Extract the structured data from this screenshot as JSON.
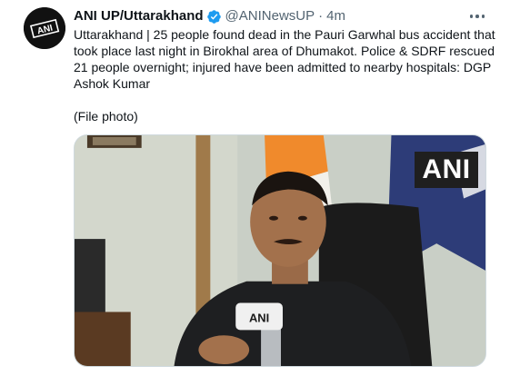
{
  "tweet": {
    "author_name": "ANI UP/Uttarakhand",
    "handle": "@ANINewsUP",
    "separator": "·",
    "time": "4m",
    "body": "Uttarakhand | 25 people found dead in the Pauri Garwhal bus accident that took place last night in Birokhal area of Dhumakot. Police & SDRF rescued 21 people overnight; injured have been admitted to nearby hospitals: DGP Ashok Kumar\n\n(File photo)",
    "media_watermark": "ANI",
    "avatar_text": "ANI",
    "mic_text": "ANI"
  },
  "icons": {
    "verified": "verified-badge-icon",
    "more": "more-options-icon"
  },
  "colors": {
    "verified_blue": "#1d9bf0",
    "secondary_text": "#536471",
    "primary_text": "#0f1419"
  }
}
